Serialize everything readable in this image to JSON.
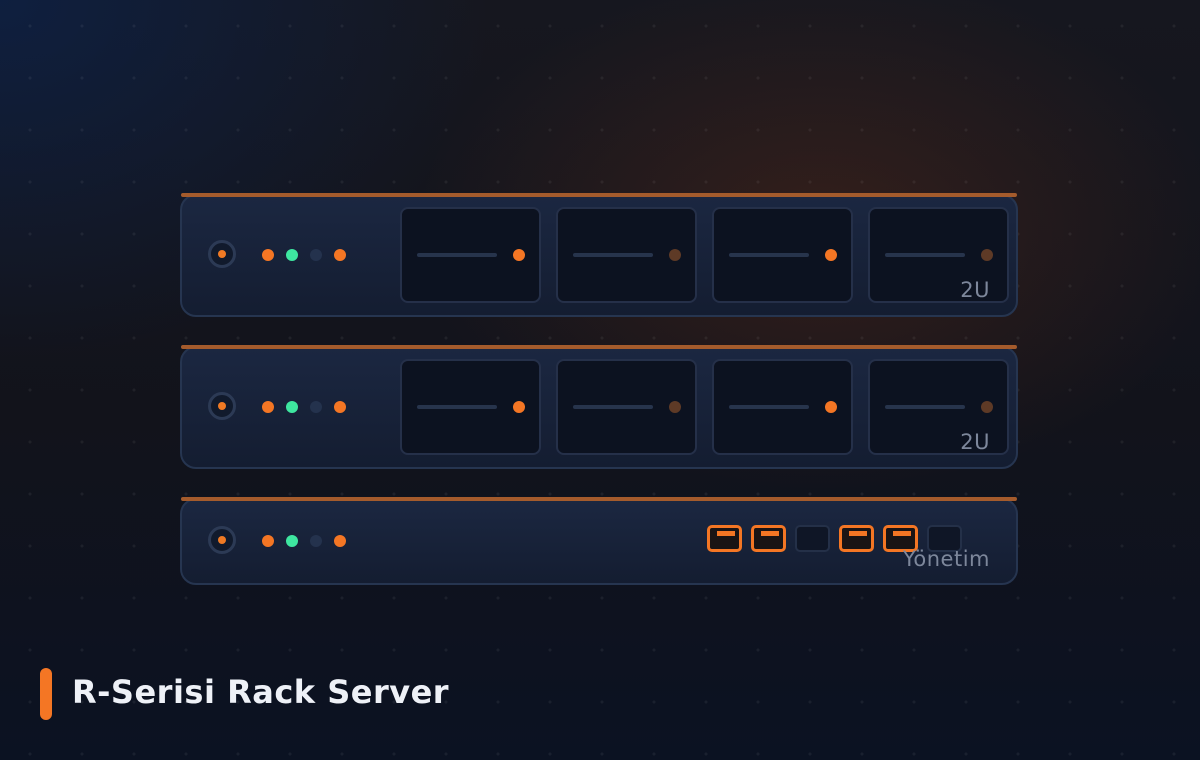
{
  "title": "R-Serisi Rack Server",
  "colors": {
    "accent": "#f47624",
    "led_green": "#3ee6a0",
    "led_off": "#24324d",
    "panel": "#1b2741",
    "border": "#263550"
  },
  "units": [
    {
      "label": "2U",
      "status_leds": [
        "orange",
        "green",
        "off",
        "orange"
      ],
      "drive_bays": [
        {
          "led": "on"
        },
        {
          "led": "dim"
        },
        {
          "led": "on"
        },
        {
          "led": "dim"
        }
      ]
    },
    {
      "label": "2U",
      "status_leds": [
        "orange",
        "green",
        "off",
        "orange"
      ],
      "drive_bays": [
        {
          "led": "on"
        },
        {
          "led": "dim"
        },
        {
          "led": "on"
        },
        {
          "led": "dim"
        }
      ]
    },
    {
      "label": "Yönetim",
      "status_leds": [
        "orange",
        "green",
        "off",
        "orange"
      ],
      "ports": [
        "active",
        "active",
        "idle",
        "active",
        "active",
        "idle"
      ]
    }
  ]
}
